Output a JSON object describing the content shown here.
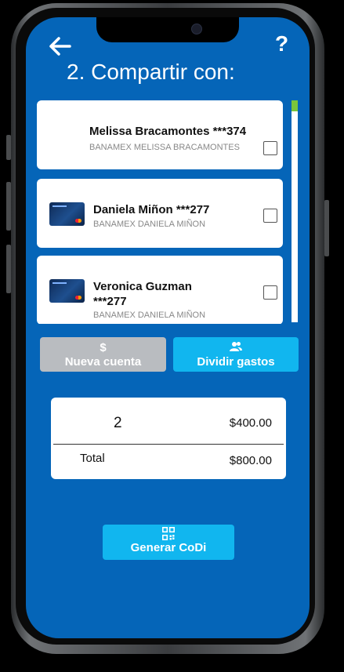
{
  "header": {
    "back_icon": "arrow-left-icon",
    "help_label": "?",
    "title": "2. Compartir con:"
  },
  "contacts": [
    {
      "name": "Melissa Bracamontes ***374",
      "bank": "BANAMEX MELISSA BRACAMONTES",
      "has_card_image": false,
      "checked": false
    },
    {
      "name": "Daniela Miñon ***277",
      "bank": "BANAMEX DANIELA MIÑON",
      "has_card_image": true,
      "checked": false
    },
    {
      "name": "Veronica Guzman ***277",
      "bank": "BANAMEX DANIELA MIÑON",
      "has_card_image": true,
      "checked": false
    }
  ],
  "actions": {
    "new_account": {
      "icon": "dollar-icon",
      "icon_glyph": "$",
      "label": "Nueva cuenta"
    },
    "split": {
      "icon": "people-icon",
      "label": "Dividir gastos"
    }
  },
  "summary": {
    "quantity": "2",
    "subtotal": "$400.00",
    "total_label": "Total",
    "total": "$800.00"
  },
  "codi": {
    "icon": "qr-code-icon",
    "label": "Generar CoDi"
  },
  "colors": {
    "background": "#0565b8",
    "accent": "#11b6ef",
    "disabled": "#b9bcc0",
    "scroll_thumb": "#7bc53c"
  }
}
